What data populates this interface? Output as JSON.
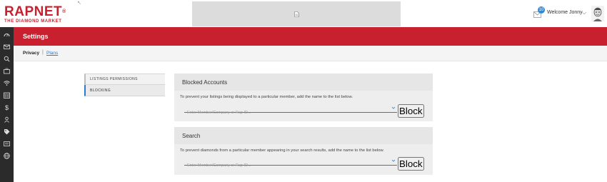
{
  "brand": {
    "name": "RAPNET",
    "tagline": "THE DIAMOND MARKET",
    "color": "#c8202f"
  },
  "header": {
    "notification_count": "10",
    "welcome_text": "Welcome Jonny",
    "ad_icon": "document-icon"
  },
  "sidebar": {
    "items": [
      {
        "icon": "dashboard-icon"
      },
      {
        "icon": "mail-icon"
      },
      {
        "icon": "search-icon"
      },
      {
        "icon": "briefcase-icon"
      },
      {
        "icon": "wifi-icon"
      },
      {
        "icon": "calendar-icon"
      },
      {
        "icon": "dollar-icon"
      },
      {
        "icon": "user-icon"
      },
      {
        "icon": "tag-icon"
      },
      {
        "icon": "news-icon"
      },
      {
        "icon": "globe-icon"
      }
    ]
  },
  "page": {
    "title": "Settings"
  },
  "subnav": {
    "privacy": "Privacy",
    "separator": "|",
    "plans": "Plans"
  },
  "tabs": [
    {
      "label": "Listings Permissions",
      "active": false
    },
    {
      "label": "Blocking",
      "active": true
    }
  ],
  "panels": {
    "blocked": {
      "title": "Blocked Accounts",
      "description": "To prevent your listings being displayed to a particular member, add the name to the list below.",
      "placeholder": "Enter Member/Company or Rap ID...",
      "button": "Block"
    },
    "search": {
      "title": "Search",
      "description": "To prevent diamonds from a particular member appearing in your search results, add the name to the list below.",
      "placeholder": "Enter Member/Company or Rap ID...",
      "button": "Block"
    }
  },
  "colors": {
    "accent": "#2e7ad1",
    "sidebar": "#2b2b2b",
    "titlebar": "#c8202f"
  }
}
